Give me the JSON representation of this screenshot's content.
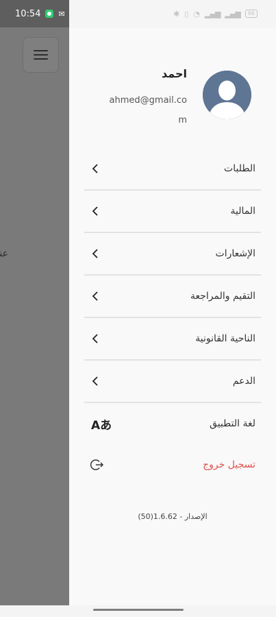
{
  "status_bar": {
    "time": "10:54",
    "right_icons": [
      "bluetooth-icon",
      "vibrate-icon",
      "wifi-icon",
      "signal-icon",
      "signal-icon",
      "battery-icon"
    ],
    "battery_level": "66"
  },
  "backdrop": {
    "partial_text": "عند"
  },
  "profile": {
    "name": "احمد",
    "email": "ahmed@gmail.com"
  },
  "menu": {
    "items": [
      {
        "label": "الطلبات",
        "icon": "chevron-left-icon"
      },
      {
        "label": "المالية",
        "icon": "chevron-left-icon"
      },
      {
        "label": "الإشعارات",
        "icon": "chevron-left-icon"
      },
      {
        "label": "التقيم والمراجعة",
        "icon": "chevron-left-icon"
      },
      {
        "label": "الناحية القانونية",
        "icon": "chevron-left-icon"
      },
      {
        "label": "الدعم",
        "icon": "chevron-left-icon"
      }
    ],
    "language": {
      "label": "لغة التطبيق",
      "icon_text": "Aあ"
    },
    "logout": {
      "label": "تسجيل خروج",
      "color": "#e0524d"
    }
  },
  "version": "الإصدار - 1.6.62(50)",
  "colors": {
    "accent_logout": "#e0524d",
    "avatar_bg": "#5f7594"
  }
}
